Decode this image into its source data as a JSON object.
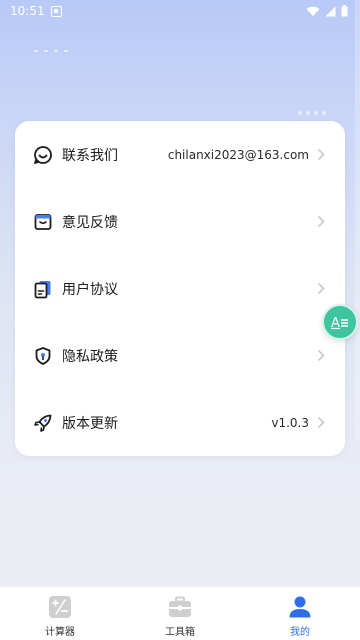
{
  "status_bar": {
    "time": "10:51"
  },
  "menu": {
    "items": [
      {
        "label": "联系我们",
        "value": "chilanxi2023@163.com",
        "icon": "smile-chat-icon"
      },
      {
        "label": "意见反馈",
        "value": "",
        "icon": "feedback-box-icon"
      },
      {
        "label": "用户协议",
        "value": "",
        "icon": "document-icon"
      },
      {
        "label": "隐私政策",
        "value": "",
        "icon": "privacy-shield-icon"
      },
      {
        "label": "版本更新",
        "value": "v1.0.3",
        "icon": "rocket-icon"
      }
    ]
  },
  "floating_button": {
    "icon": "text-format-icon",
    "text": "A"
  },
  "tabs": [
    {
      "label": "计算器",
      "icon": "calculator-icon",
      "active": false
    },
    {
      "label": "工具箱",
      "icon": "toolbox-icon",
      "active": false
    },
    {
      "label": "我的",
      "icon": "user-icon",
      "active": true
    }
  ],
  "colors": {
    "accent": "#2f6fe8",
    "fab": "#3ec5a0",
    "inactive_icon": "#cfcfcf"
  }
}
